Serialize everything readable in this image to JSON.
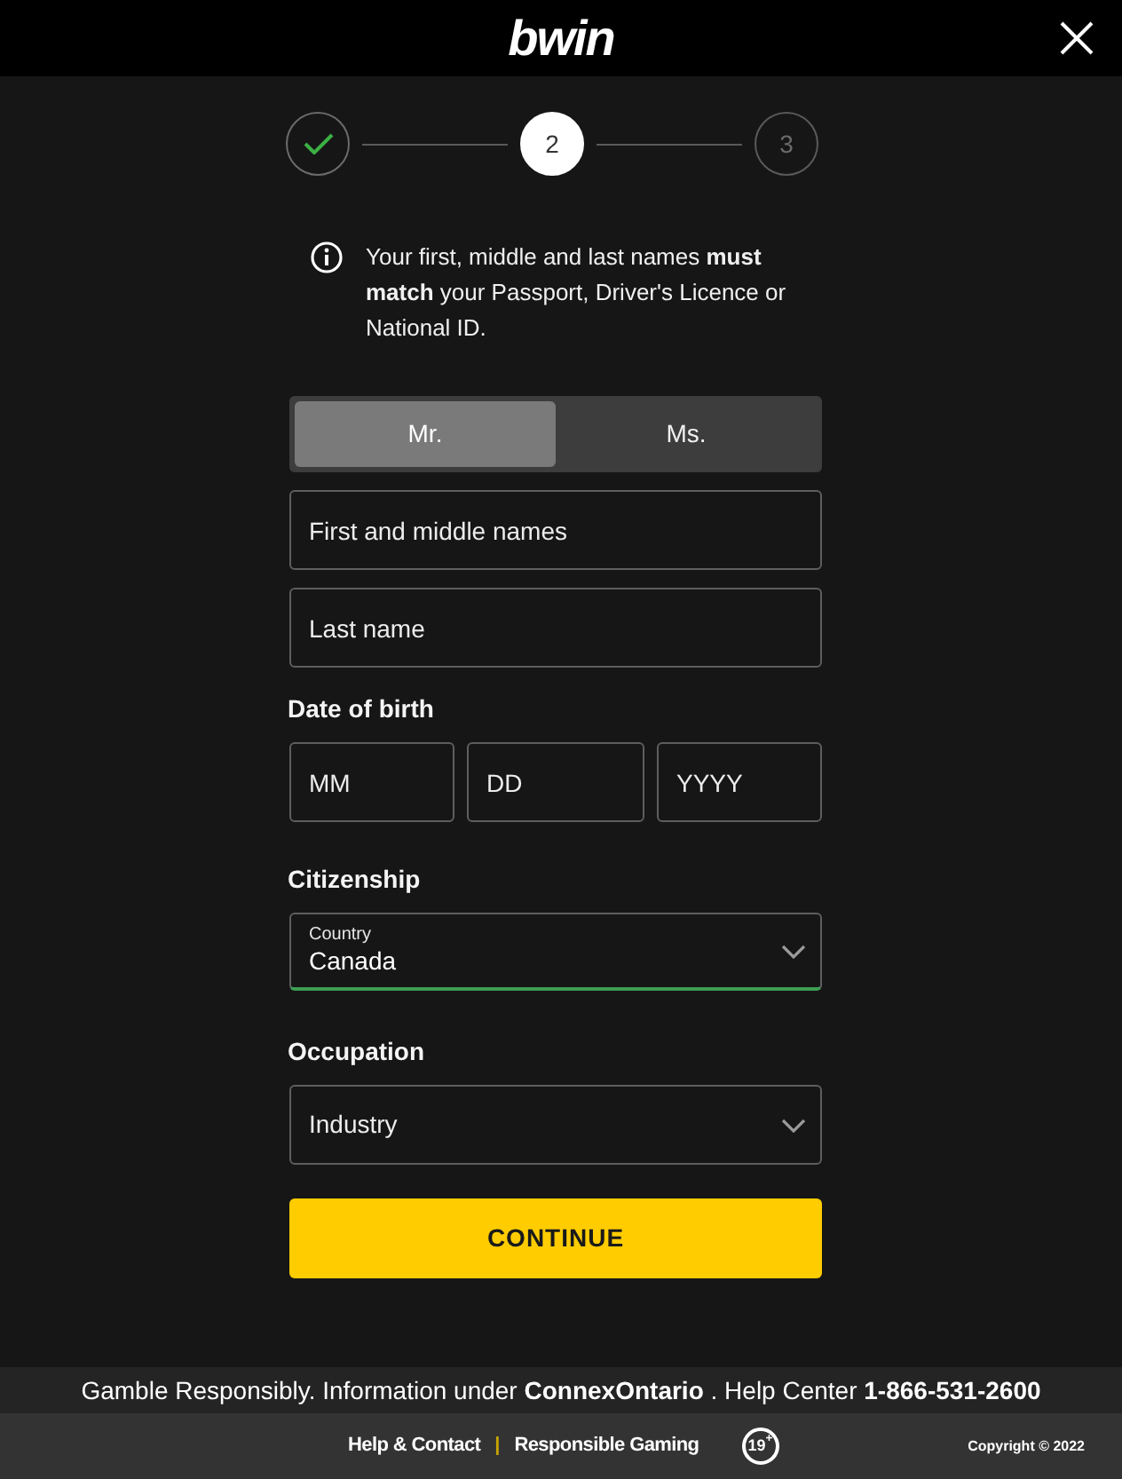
{
  "header": {
    "logo": "bwin"
  },
  "steps": [
    {
      "completed": true,
      "selected": false
    },
    {
      "label": "2",
      "completed": false,
      "selected": true
    },
    {
      "label": "3",
      "completed": false,
      "selected": false
    }
  ],
  "notice": {
    "text": "Your first, middle and last names **must match** your Passport, Driver's Licence or National ID."
  },
  "salutation": [
    {
      "label": "Mr.",
      "selected": true
    },
    {
      "label": "Ms.",
      "selected": false
    }
  ],
  "name_fields": [
    {
      "placeholder": "First and middle names"
    },
    {
      "placeholder": "Last name"
    }
  ],
  "date_of_birth": {
    "label": "Date of birth",
    "fields": [
      {
        "placeholder": "MM"
      },
      {
        "placeholder": "DD"
      },
      {
        "placeholder": "YYYY"
      }
    ]
  },
  "citizenship": {
    "label": "Citizenship",
    "field_label": "Country",
    "value": "Canada",
    "valid": true
  },
  "occupation": {
    "label": "Occupation",
    "placeholder": "Industry"
  },
  "continue_button": {
    "label": "CONTINUE"
  },
  "footer": {
    "notice": "Gamble Responsibly. Information under **ConnexOntario** . Help Center **1-866-531-2600**",
    "links": [
      "Help & Contact",
      "Responsible Gaming"
    ],
    "separator": "|",
    "age_badge": "19$^{+}$",
    "copyright": "Copyright © 2022"
  }
}
